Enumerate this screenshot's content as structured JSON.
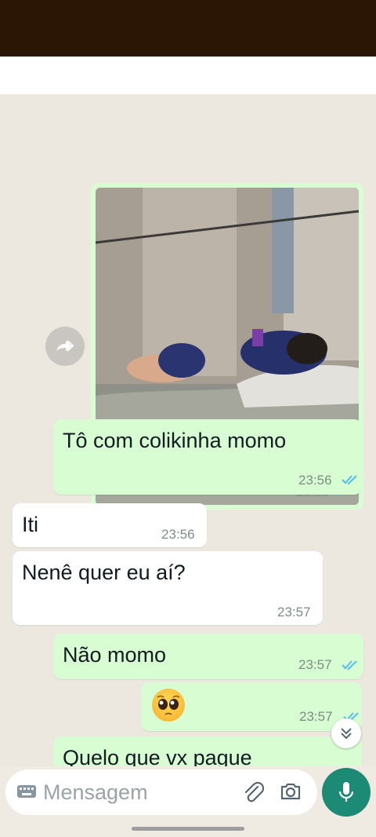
{
  "chat": {
    "image_message": {
      "time": "23:56",
      "status": "read"
    },
    "messages": [
      {
        "direction": "out",
        "text": "Tô com colikinha momo",
        "time": "23:56",
        "status": "read"
      },
      {
        "direction": "in",
        "text": "Iti",
        "time": "23:56"
      },
      {
        "direction": "in",
        "text": "Nenê quer eu aí?",
        "time": "23:57"
      },
      {
        "direction": "out",
        "text": "Não momo",
        "time": "23:57",
        "status": "read"
      },
      {
        "direction": "out",
        "text": "🥺",
        "time": "23:57",
        "status": "read"
      },
      {
        "direction": "out",
        "text": "Quelo que vx pague",
        "time": "",
        "status": ""
      }
    ]
  },
  "composer": {
    "placeholder": "Mensagem",
    "icons": [
      "keyboard-icon",
      "attach-icon",
      "camera-icon",
      "mic-icon"
    ]
  },
  "icons": {
    "forward": "forward-icon",
    "scroll_down": "chevron-double-down-icon"
  },
  "colors": {
    "status_bar": "#2b1606",
    "outgoing_bubble": "#d9fdd3",
    "incoming_bubble": "#ffffff",
    "read_tick": "#53bdeb",
    "mic_button": "#1c8a74"
  }
}
